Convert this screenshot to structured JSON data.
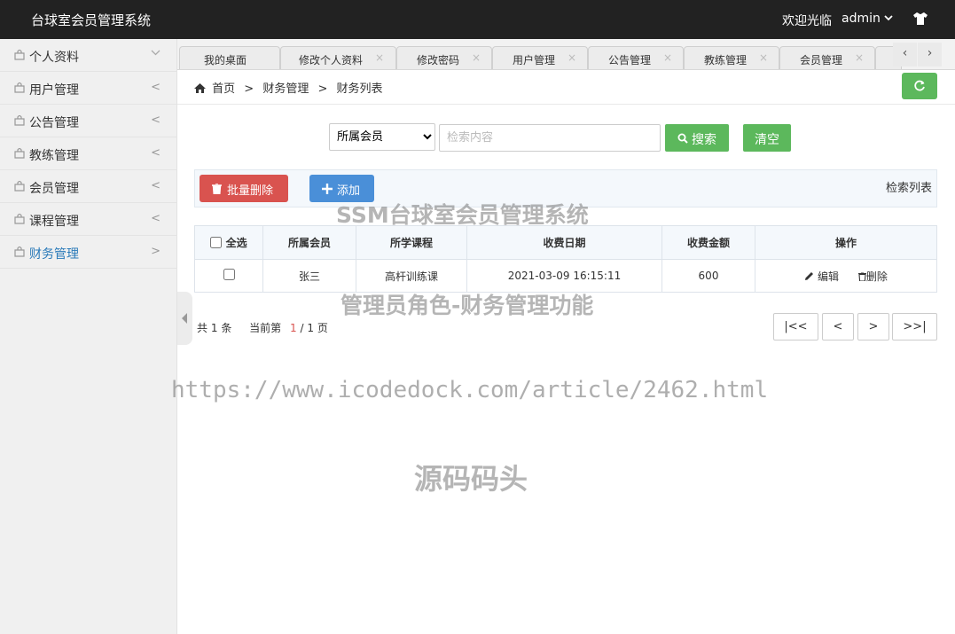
{
  "app": {
    "title": "台球室会员管理系统",
    "welcome": "欢迎光临",
    "user": "admin"
  },
  "sidebar": {
    "items": [
      {
        "label": "个人资料",
        "arrow": "∨"
      },
      {
        "label": "用户管理",
        "arrow": "<"
      },
      {
        "label": "公告管理",
        "arrow": "<"
      },
      {
        "label": "教练管理",
        "arrow": "<"
      },
      {
        "label": "会员管理",
        "arrow": "<"
      },
      {
        "label": "课程管理",
        "arrow": "<"
      },
      {
        "label": "财务管理",
        "arrow": ">"
      }
    ]
  },
  "tabs": [
    {
      "label": "我的桌面"
    },
    {
      "label": "修改个人资料",
      "close": "×"
    },
    {
      "label": "修改密码",
      "close": "×"
    },
    {
      "label": "用户管理",
      "close": "×"
    },
    {
      "label": "公告管理",
      "close": "×"
    },
    {
      "label": "教练管理",
      "close": "×"
    },
    {
      "label": "会员管理",
      "close": "×"
    }
  ],
  "tab_nav": {
    "prev": "‹",
    "next": "›"
  },
  "breadcrumb": {
    "home": "首页",
    "sep": ">",
    "level1": "财务管理",
    "level2": "财务列表"
  },
  "search": {
    "select_value": "所属会员",
    "placeholder": "检索内容",
    "search_label": "搜索",
    "clear_label": "清空"
  },
  "toolbar": {
    "batch_delete_label": "批量删除",
    "add_label": "添加",
    "right_label": "检索列表"
  },
  "table": {
    "select_all_label": "全选",
    "headers": [
      "所属会员",
      "所学课程",
      "收费日期",
      "收费金额",
      "操作"
    ],
    "rows": [
      {
        "member": "张三",
        "course": "高杆训练课",
        "date": "2021-03-09 16:15:11",
        "amount": "600",
        "edit_label": "编辑",
        "delete_label": "删除"
      }
    ]
  },
  "pager": {
    "total_prefix": "共",
    "total": "1",
    "total_suffix": "条",
    "page_prefix": "当前第",
    "current": "1",
    "page_sep": "/",
    "pages": "1",
    "page_suffix": "页",
    "first": "|<<",
    "prev": "<",
    "next": ">",
    "last": ">>|"
  },
  "watermarks": {
    "line1": "SSM台球室会员管理系统",
    "line2": "管理员角色-财务管理功能",
    "url": "https://www.icodedock.com/article/2462.html",
    "brand": "源码码头"
  },
  "colors": {
    "topbar": "#222222",
    "success": "#5cb85c",
    "danger": "#d9534f",
    "primary": "#4a8fd8",
    "active_link": "#2a7ab9"
  }
}
